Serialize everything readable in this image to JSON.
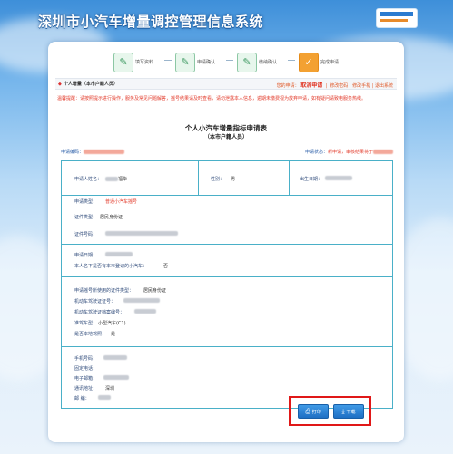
{
  "header": {
    "system_title": "深圳市小汽车增量调控管理信息系统"
  },
  "steps": [
    {
      "label": "填写资料",
      "icon": "form-icon"
    },
    {
      "label": "申请确认",
      "icon": "form-icon"
    },
    {
      "label": "缴纳确认",
      "icon": "form-icon"
    },
    {
      "label": "完成申请",
      "icon": "checkmark-icon"
    }
  ],
  "notice_bar": {
    "title": "个人增量（本市户籍人员）",
    "status_prefix": "您的申请：",
    "status": "取消申请",
    "links": "修改密码 | 修改手机 | 退出系统"
  },
  "warning": "温馨提醒：请按照提示进行操作，服务及常见问题解答，摇号结果请及时查看，请勿泄露本人信息，逾期未缴费视为放弃申请，如有疑问请致电服务热线。",
  "form": {
    "title": "个人小汽车增量指标申请表",
    "subtitle": "（本市户籍人员）",
    "code_label": "申请编码：",
    "status_label": "申请状态：",
    "status_value": "新申请，审核结果将于",
    "rows": {
      "name_label": "申请人姓名：",
      "name_value": "福华",
      "gender_label": "性别：",
      "gender_value": "男",
      "birth_label": "出生日期：",
      "type_label": "申请类型：",
      "type_value": "普通小汽车摇号",
      "id_type_label": "证件类型：",
      "id_type_value": "居民身份证",
      "id_no_label": "证件号码：",
      "apply_date_label": "申请日期：",
      "owned_label": "本人名下是否有本市登记的小汽车：",
      "owned_value": "否",
      "prev_id_type_label": "申请摇号所使用的证件类型：",
      "prev_id_type_value": "居民身份证",
      "plate_no_label": "机动车驾驶证证号：",
      "plate_type_label": "机动车驾驶证档案编号：",
      "car_type_label": "准驾车型：",
      "car_type_value": "小型汽车(C1)",
      "local_label": "是否本地驾照：",
      "local_value": "是",
      "phone_label": "手机号码：",
      "fixed_label": "固定电话：",
      "email_label": "电子邮箱：",
      "addr_label": "通讯地址：",
      "addr_value": "深圳",
      "zip_label": "邮   编："
    }
  },
  "buttons": {
    "print_label": "打印",
    "download_label": "下载"
  },
  "colors": {
    "accent": "#1f6fc4",
    "warning": "#e23a2a",
    "highlight_box": "#e01818",
    "table_border": "#4ab0c8"
  }
}
